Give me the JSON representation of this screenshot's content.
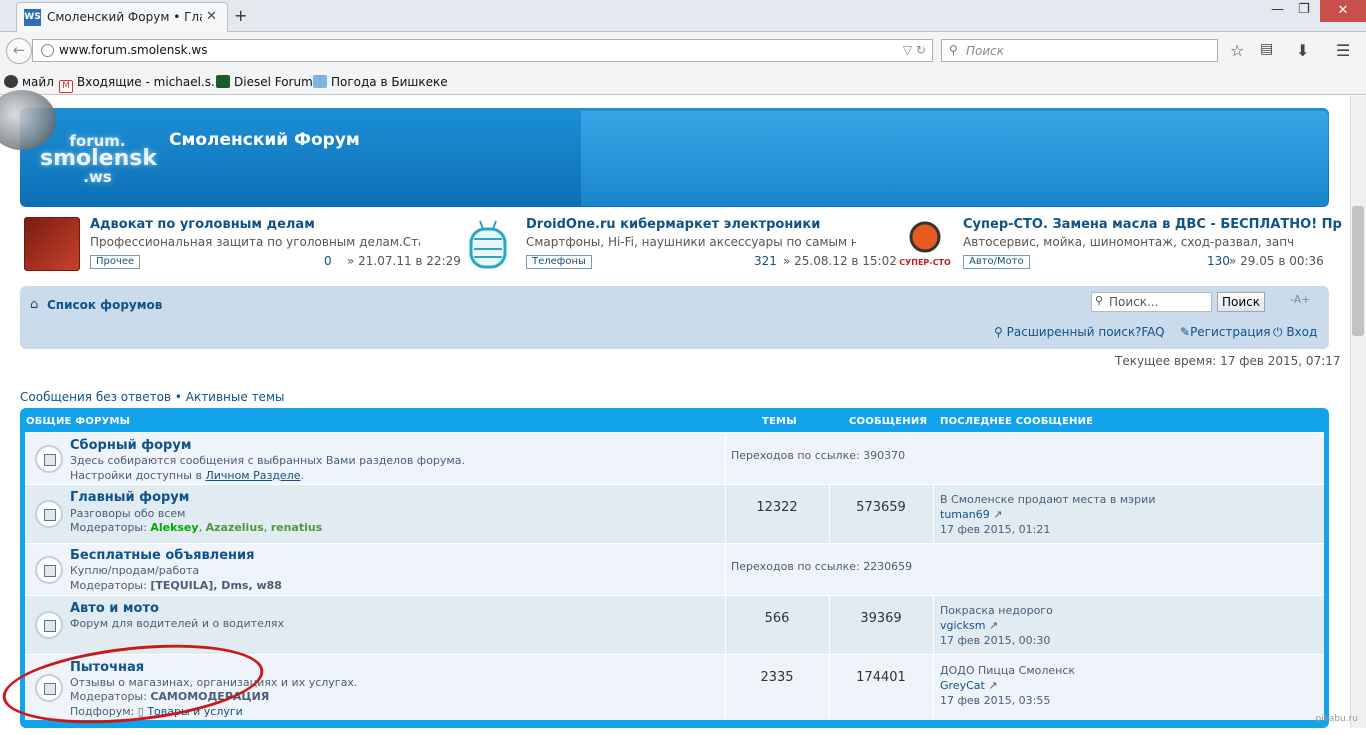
{
  "browser": {
    "tab_title": "Смоленский Форум • Гла...",
    "tab_favicon": "WS",
    "url": "www.forum.smolensk.ws",
    "search_placeholder": "Поиск",
    "bookmarks": [
      {
        "label": "майл",
        "icon": "mail-icon"
      },
      {
        "label": "Входящие - michael.s...",
        "icon": "gmail-icon"
      },
      {
        "label": "Diesel Forum",
        "icon": "diesel-icon"
      },
      {
        "label": "Погода в Бишкеке",
        "icon": "weather-icon"
      }
    ]
  },
  "site": {
    "logo_top": "forum.",
    "logo_mid": "smolensk",
    "logo_bottom": ".ws",
    "title": "Смоленский Форум"
  },
  "ads": [
    {
      "title": "Адвокат по уголовным делам",
      "desc": "Профессиональная защита по уголовным делам.Ста...",
      "tag": "Прочее",
      "count": "0",
      "date": "» 21.07.11 в 22:29"
    },
    {
      "title": "DroidOne.ru кибермаркет электроники",
      "desc": "Смартфоны, Hi-Fi, наушники аксессуары по самым н...",
      "tag": "Телефоны",
      "count": "321",
      "date": "» 25.08.12 в 15:02"
    },
    {
      "title": "Супер-СТО. Замена масла в ДВС - БЕСПЛАТНО! Пр",
      "desc": "Автосервис, мойка, шиномонтаж, сход-развал, запч...",
      "tag": "Авто/Мото",
      "count": "130",
      "date": "» 29.05 в 00:36"
    }
  ],
  "nav": {
    "forum_list": "Список форумов",
    "search_placeholder": "Поиск...",
    "search_button": "Поиск",
    "font_size": "-A+",
    "adv_search": "Расширенный поиск",
    "faq": "FAQ",
    "register": "Регистрация",
    "login": "Вход",
    "current_time": "Текущее время: 17 фев 2015, 07:17",
    "unanswered": "Сообщения без ответов",
    "separator": "•",
    "active": "Активные темы"
  },
  "table": {
    "headers": [
      "ОБЩИЕ ФОРУМЫ",
      "ТЕМЫ",
      "СООБЩЕНИЯ",
      "ПОСЛЕДНЕЕ СООБЩЕНИЕ"
    ],
    "rows": [
      {
        "title": "Сборный форум",
        "desc": "Здесь собираются сообщения с выбранных Вами разделов форума.",
        "desc2_prefix": "Настройки доступны в ",
        "desc2_link": "Личном Разделе",
        "desc2_suffix": ".",
        "redirect": "Переходов по ссылке: 390370"
      },
      {
        "title": "Главный форум",
        "desc": "Разговоры обо всем",
        "mods_label": "Модераторы: ",
        "mods": [
          "Aleksey",
          "Azazelius",
          "renatius"
        ],
        "topics": "12322",
        "posts": "573659",
        "last_title": "В Смоленске продают места в мэрии",
        "last_user": "tuman69",
        "last_date": "17 фев 2015, 01:21"
      },
      {
        "title": "Бесплатные объявления",
        "desc": "Куплю/продам/работа",
        "mods_label": "Модераторы: ",
        "mods_text": "[TEQUILA], Dms, w88",
        "redirect": "Переходов по ссылке: 2230659"
      },
      {
        "title": "Авто и мото",
        "desc": "Форум для водителей и о водителях",
        "topics": "566",
        "posts": "39369",
        "last_title": "Покраска недорого",
        "last_user": "vgicksm",
        "last_date": "17 фев 2015, 00:30"
      },
      {
        "title": "Пыточная",
        "desc": "Отзывы о магазинах, организациях и их услугах.",
        "mods_label": "Модераторы: ",
        "mods_text": "САМОМОДЕРАЦИЯ",
        "sub_label": "Подфорум: ",
        "sub_link": "Товары и услуги",
        "topics": "2335",
        "posts": "174401",
        "last_title": "ДОДО Пицца Смоленск",
        "last_user": "GreyCat",
        "last_date": "17 фев 2015, 03:55"
      }
    ]
  },
  "watermark": "pikabu.ru",
  "colors": {
    "header_blue": "#0d6fb3",
    "table_blue": "#12a3eb",
    "link": "#105289",
    "annotation_red": "#c81a1a"
  }
}
